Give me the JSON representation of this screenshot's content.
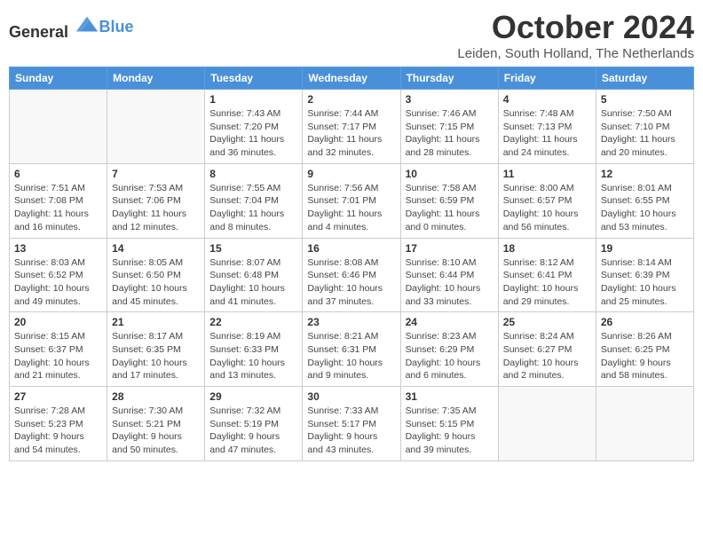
{
  "logo": {
    "general": "General",
    "blue": "Blue"
  },
  "title": "October 2024",
  "subtitle": "Leiden, South Holland, The Netherlands",
  "days_of_week": [
    "Sunday",
    "Monday",
    "Tuesday",
    "Wednesday",
    "Thursday",
    "Friday",
    "Saturday"
  ],
  "weeks": [
    [
      {
        "day": "",
        "info": ""
      },
      {
        "day": "",
        "info": ""
      },
      {
        "day": "1",
        "info": "Sunrise: 7:43 AM\nSunset: 7:20 PM\nDaylight: 11 hours and 36 minutes."
      },
      {
        "day": "2",
        "info": "Sunrise: 7:44 AM\nSunset: 7:17 PM\nDaylight: 11 hours and 32 minutes."
      },
      {
        "day": "3",
        "info": "Sunrise: 7:46 AM\nSunset: 7:15 PM\nDaylight: 11 hours and 28 minutes."
      },
      {
        "day": "4",
        "info": "Sunrise: 7:48 AM\nSunset: 7:13 PM\nDaylight: 11 hours and 24 minutes."
      },
      {
        "day": "5",
        "info": "Sunrise: 7:50 AM\nSunset: 7:10 PM\nDaylight: 11 hours and 20 minutes."
      }
    ],
    [
      {
        "day": "6",
        "info": "Sunrise: 7:51 AM\nSunset: 7:08 PM\nDaylight: 11 hours and 16 minutes."
      },
      {
        "day": "7",
        "info": "Sunrise: 7:53 AM\nSunset: 7:06 PM\nDaylight: 11 hours and 12 minutes."
      },
      {
        "day": "8",
        "info": "Sunrise: 7:55 AM\nSunset: 7:04 PM\nDaylight: 11 hours and 8 minutes."
      },
      {
        "day": "9",
        "info": "Sunrise: 7:56 AM\nSunset: 7:01 PM\nDaylight: 11 hours and 4 minutes."
      },
      {
        "day": "10",
        "info": "Sunrise: 7:58 AM\nSunset: 6:59 PM\nDaylight: 11 hours and 0 minutes."
      },
      {
        "day": "11",
        "info": "Sunrise: 8:00 AM\nSunset: 6:57 PM\nDaylight: 10 hours and 56 minutes."
      },
      {
        "day": "12",
        "info": "Sunrise: 8:01 AM\nSunset: 6:55 PM\nDaylight: 10 hours and 53 minutes."
      }
    ],
    [
      {
        "day": "13",
        "info": "Sunrise: 8:03 AM\nSunset: 6:52 PM\nDaylight: 10 hours and 49 minutes."
      },
      {
        "day": "14",
        "info": "Sunrise: 8:05 AM\nSunset: 6:50 PM\nDaylight: 10 hours and 45 minutes."
      },
      {
        "day": "15",
        "info": "Sunrise: 8:07 AM\nSunset: 6:48 PM\nDaylight: 10 hours and 41 minutes."
      },
      {
        "day": "16",
        "info": "Sunrise: 8:08 AM\nSunset: 6:46 PM\nDaylight: 10 hours and 37 minutes."
      },
      {
        "day": "17",
        "info": "Sunrise: 8:10 AM\nSunset: 6:44 PM\nDaylight: 10 hours and 33 minutes."
      },
      {
        "day": "18",
        "info": "Sunrise: 8:12 AM\nSunset: 6:41 PM\nDaylight: 10 hours and 29 minutes."
      },
      {
        "day": "19",
        "info": "Sunrise: 8:14 AM\nSunset: 6:39 PM\nDaylight: 10 hours and 25 minutes."
      }
    ],
    [
      {
        "day": "20",
        "info": "Sunrise: 8:15 AM\nSunset: 6:37 PM\nDaylight: 10 hours and 21 minutes."
      },
      {
        "day": "21",
        "info": "Sunrise: 8:17 AM\nSunset: 6:35 PM\nDaylight: 10 hours and 17 minutes."
      },
      {
        "day": "22",
        "info": "Sunrise: 8:19 AM\nSunset: 6:33 PM\nDaylight: 10 hours and 13 minutes."
      },
      {
        "day": "23",
        "info": "Sunrise: 8:21 AM\nSunset: 6:31 PM\nDaylight: 10 hours and 9 minutes."
      },
      {
        "day": "24",
        "info": "Sunrise: 8:23 AM\nSunset: 6:29 PM\nDaylight: 10 hours and 6 minutes."
      },
      {
        "day": "25",
        "info": "Sunrise: 8:24 AM\nSunset: 6:27 PM\nDaylight: 10 hours and 2 minutes."
      },
      {
        "day": "26",
        "info": "Sunrise: 8:26 AM\nSunset: 6:25 PM\nDaylight: 9 hours and 58 minutes."
      }
    ],
    [
      {
        "day": "27",
        "info": "Sunrise: 7:28 AM\nSunset: 5:23 PM\nDaylight: 9 hours and 54 minutes."
      },
      {
        "day": "28",
        "info": "Sunrise: 7:30 AM\nSunset: 5:21 PM\nDaylight: 9 hours and 50 minutes."
      },
      {
        "day": "29",
        "info": "Sunrise: 7:32 AM\nSunset: 5:19 PM\nDaylight: 9 hours and 47 minutes."
      },
      {
        "day": "30",
        "info": "Sunrise: 7:33 AM\nSunset: 5:17 PM\nDaylight: 9 hours and 43 minutes."
      },
      {
        "day": "31",
        "info": "Sunrise: 7:35 AM\nSunset: 5:15 PM\nDaylight: 9 hours and 39 minutes."
      },
      {
        "day": "",
        "info": ""
      },
      {
        "day": "",
        "info": ""
      }
    ]
  ]
}
